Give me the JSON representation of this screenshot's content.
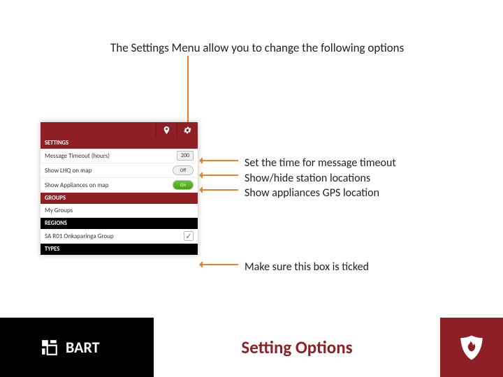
{
  "intro": "The Settings Menu allow you to change the following options",
  "panel": {
    "section_settings": "SETTINGS",
    "msg_timeout_label": "Message Timeout (hours)",
    "msg_timeout_value": "200",
    "show_lhq_label": "Show LHQ on map",
    "show_lhq_value": "Off",
    "show_appl_label": "Show Appliances on map",
    "show_appl_value": "On",
    "section_groups": "GROUPS",
    "my_groups_label": "My Groups",
    "section_regions": "REGIONS",
    "region_label": "SA R01 Onkaparinga Group",
    "region_checked": "✓",
    "section_types": "TYPES"
  },
  "callouts": {
    "c1": "Set the time for message timeout",
    "c2": "Show/hide station locations",
    "c3": "Show appliances GPS location",
    "c4": "Make sure this box is ticked"
  },
  "footer": {
    "brand": "BART",
    "slide_title": "Setting Options"
  }
}
